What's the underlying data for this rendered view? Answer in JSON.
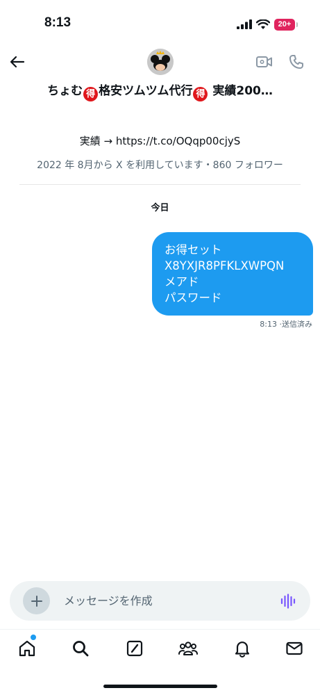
{
  "status_bar": {
    "time": "8:13",
    "battery": "20+"
  },
  "header": {
    "title_parts": [
      "ちょむ",
      "得",
      "格安ツムツム代行",
      "得",
      " 実績200…"
    ]
  },
  "profile": {
    "bio": "実績 → https://t.co/OQqp00cjyS",
    "meta": "2022 年 8月から X を利用しています・860 フォロワー"
  },
  "conversation": {
    "day_label": "今日",
    "message": {
      "lines": [
        "お得セット",
        "X8YXJR8PFKLXWPQN",
        "メアド",
        "パスワード"
      ],
      "meta": "8:13 ·送信済み"
    }
  },
  "composer": {
    "placeholder": "メッセージを作成"
  },
  "tabbar": {
    "items": [
      "home",
      "search",
      "grok",
      "communities",
      "notifications",
      "messages"
    ]
  },
  "colors": {
    "accent": "#1d9bf0",
    "badge": "#e0171c",
    "muted": "#536471",
    "voice": "#7856ff"
  }
}
